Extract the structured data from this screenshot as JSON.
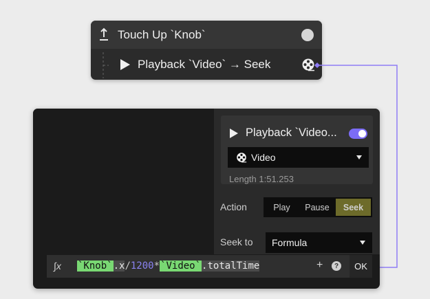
{
  "trigger": {
    "title": "Touch Up `Knob`",
    "action_title": "Playback `Video` → Seek"
  },
  "inspector": {
    "card_title": "Playback `Video...",
    "enabled": true,
    "media_value": "Video",
    "length": "Length 1:51.253",
    "action_label": "Action",
    "action_options": [
      "Play",
      "Pause",
      "Seek"
    ],
    "action_selected": "Seek",
    "seek_label": "Seek to",
    "seek_value": "Formula"
  },
  "formula": {
    "fx_icon": "∫x",
    "tokens": {
      "ref1": "`Knob`",
      "prop1": ".x",
      "op1": "/",
      "num1": "1200",
      "op2": "*",
      "ref2": "`Video`",
      "prop2": ".totalTime"
    },
    "plus_label": "+",
    "help_label": "?",
    "ok_label": "OK"
  },
  "colors": {
    "accent": "#7b6cf6",
    "seek_selected": "#6d6b2a",
    "formula_ref": "#79d873",
    "formula_number": "#8a83f2",
    "connector": "#8f7cf5"
  }
}
